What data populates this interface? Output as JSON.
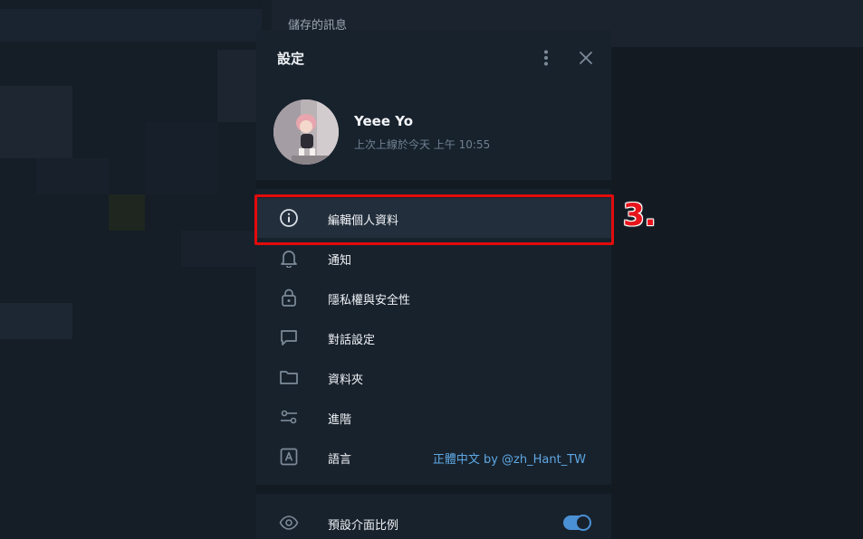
{
  "background": {
    "chat_title": "儲存的訊息"
  },
  "settings": {
    "title": "設定",
    "more_icon": "more-vertical-icon",
    "close_icon": "close-icon",
    "profile": {
      "name": "Yeee Yo",
      "status": "上次上線於今天 上午 10:55"
    },
    "menu": [
      {
        "label": "編輯個人資料",
        "icon": "info-icon"
      },
      {
        "label": "通知",
        "icon": "bell-icon"
      },
      {
        "label": "隱私權與安全性",
        "icon": "lock-icon"
      },
      {
        "label": "對話設定",
        "icon": "chat-bubble-icon"
      },
      {
        "label": "資料夾",
        "icon": "folder-icon"
      },
      {
        "label": "進階",
        "icon": "sliders-icon"
      },
      {
        "label": "語言",
        "icon": "language-icon",
        "value": "正體中文 by @zh_Hant_TW"
      }
    ],
    "bottom_menu": [
      {
        "label": "預設介面比例",
        "icon": "eye-icon",
        "toggle": true
      }
    ]
  },
  "annotation": {
    "text": "3.",
    "color": "#e30b0b"
  }
}
